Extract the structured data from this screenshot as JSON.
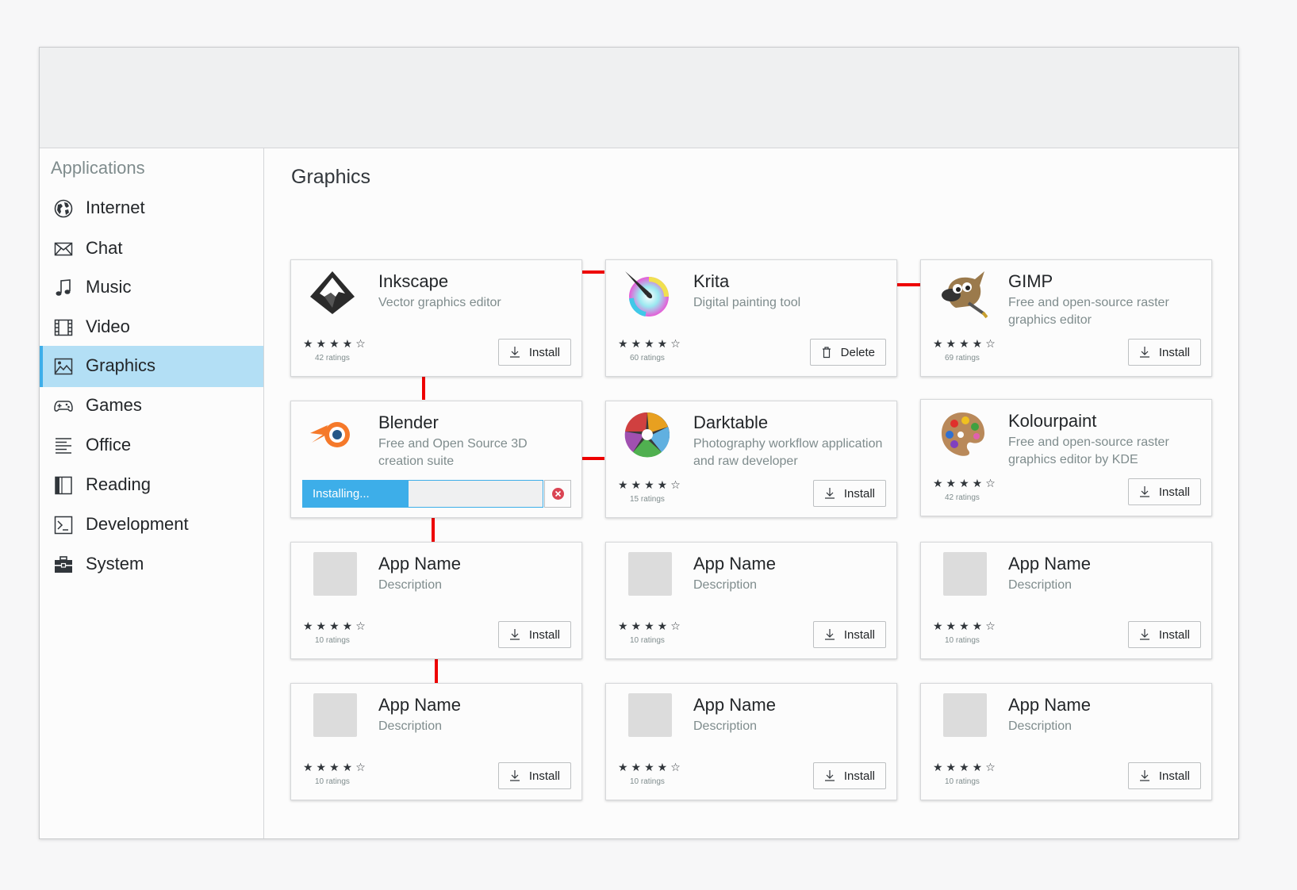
{
  "sidebar": {
    "heading": "Applications",
    "items": [
      {
        "label": "Internet",
        "icon": "globe-icon"
      },
      {
        "label": "Chat",
        "icon": "envelope-icon"
      },
      {
        "label": "Music",
        "icon": "music-note-icon"
      },
      {
        "label": "Video",
        "icon": "film-strip-icon"
      },
      {
        "label": "Graphics",
        "icon": "picture-icon",
        "selected": true
      },
      {
        "label": "Games",
        "icon": "gamepad-icon"
      },
      {
        "label": "Office",
        "icon": "text-lines-icon"
      },
      {
        "label": "Reading",
        "icon": "book-icon"
      },
      {
        "label": "Development",
        "icon": "terminal-icon"
      },
      {
        "label": "System",
        "icon": "toolbox-icon"
      }
    ]
  },
  "main": {
    "title": "Graphics",
    "cards": [
      {
        "name": "Inkscape",
        "description": "Vector graphics editor",
        "stars": "★★★★☆",
        "rating": 4,
        "ratings": "42 ratings",
        "action": "Install",
        "icon": "inkscape-icon"
      },
      {
        "name": "Krita",
        "description": "Digital painting tool",
        "stars": "★★★★☆",
        "rating": 4,
        "ratings": "60 ratings",
        "action": "Delete",
        "icon": "krita-icon"
      },
      {
        "name": "GIMP",
        "description": "Free and open-source raster graphics editor",
        "stars": "★★★★☆",
        "rating": 4,
        "ratings": "69 ratings",
        "action": "Install",
        "icon": "gimp-icon"
      },
      {
        "name": "Blender",
        "description": "Free and Open Source 3D creation suite",
        "progress_label": "Installing...",
        "progress": 0.44,
        "icon": "blender-icon"
      },
      {
        "name": "Darktable",
        "description": "Photography workflow application and raw developer",
        "stars": "★★★★☆",
        "rating": 4,
        "ratings": "15 ratings",
        "action": "Install",
        "icon": "darktable-icon"
      },
      {
        "name": "Kolourpaint",
        "description": "Free and open-source raster graphics editor by KDE",
        "stars": "★★★★☆",
        "rating": 4,
        "ratings": "42 ratings",
        "action": "Install",
        "icon": "kolourpaint-icon"
      },
      {
        "name": "App Name",
        "description": "Description",
        "stars": "★★★★☆",
        "rating": 4,
        "ratings": "10 ratings",
        "action": "Install"
      },
      {
        "name": "App Name",
        "description": "Description",
        "stars": "★★★★☆",
        "rating": 4,
        "ratings": "10 ratings",
        "action": "Install"
      },
      {
        "name": "App Name",
        "description": "Description",
        "stars": "★★★★☆",
        "rating": 4,
        "ratings": "10 ratings",
        "action": "Install"
      },
      {
        "name": "App Name",
        "description": "Description",
        "stars": "★★★★☆",
        "rating": 4,
        "ratings": "10 ratings",
        "action": "Install"
      },
      {
        "name": "App Name",
        "description": "Description",
        "stars": "★★★★☆",
        "rating": 4,
        "ratings": "10 ratings",
        "action": "Install"
      },
      {
        "name": "App Name",
        "description": "Description",
        "stars": "★★★★☆",
        "rating": 4,
        "ratings": "10 ratings",
        "action": "Install"
      }
    ]
  },
  "colors": {
    "accent": "#3daee9",
    "selection": "#b3dff5",
    "connector": "#ee0000",
    "cancel": "#da4453"
  }
}
